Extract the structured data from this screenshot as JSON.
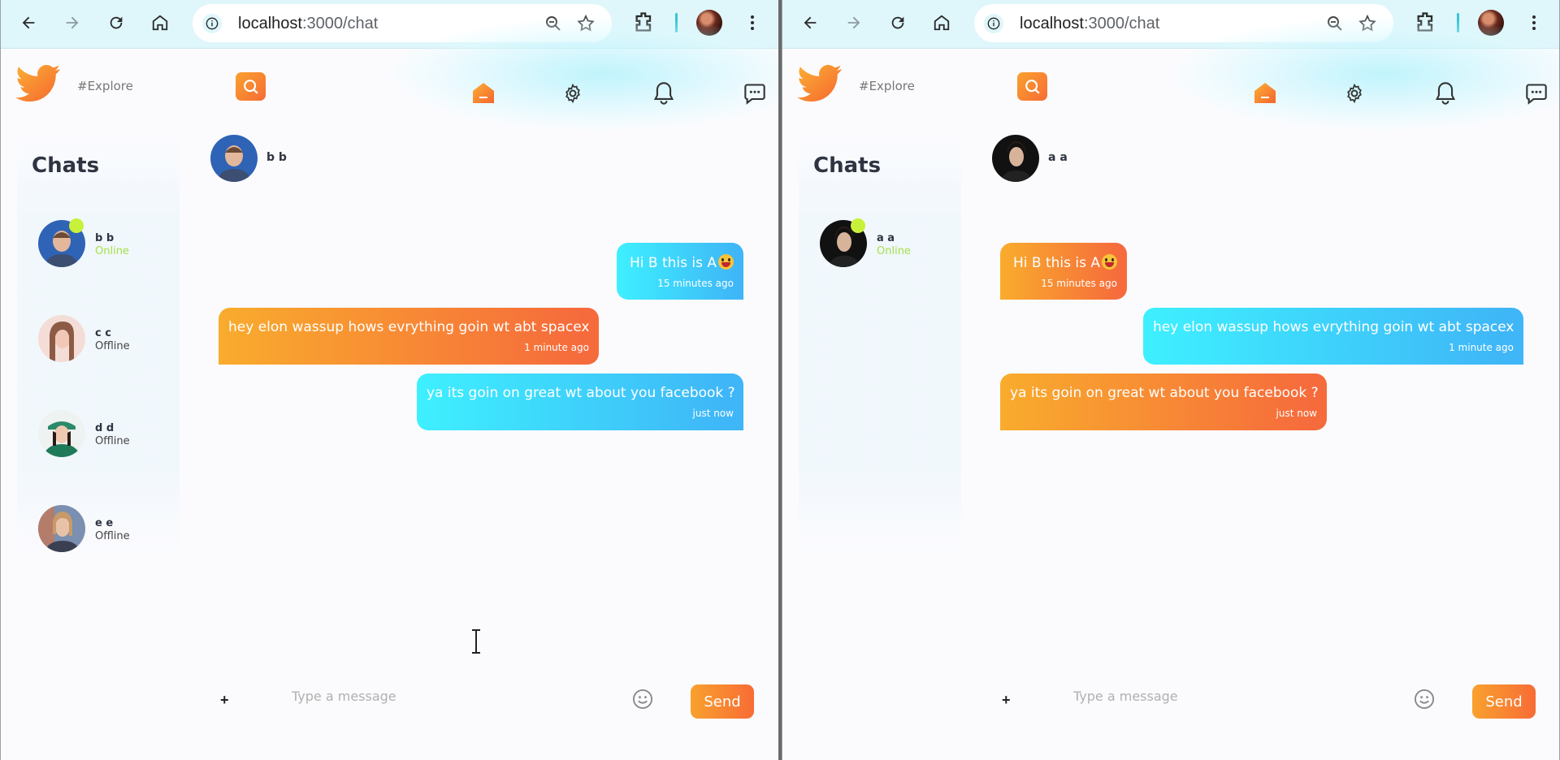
{
  "browser": {
    "url_host": "localhost",
    "url_path": ":3000/chat"
  },
  "header": {
    "explore_label": "#Explore"
  },
  "colors": {
    "accent_orange": "#f76c35",
    "accent_blue": "#3fb6f7",
    "online_green": "#c8f13a"
  },
  "windows": [
    {
      "chats_title": "Chats",
      "contacts": [
        {
          "name": "b b",
          "status": "Online",
          "online": true
        },
        {
          "name": "c c",
          "status": "Offline",
          "online": false
        },
        {
          "name": "d d",
          "status": "Offline",
          "online": false
        },
        {
          "name": "e e",
          "status": "Offline",
          "online": false
        }
      ],
      "conversation": {
        "name": "b b",
        "messages": [
          {
            "text": "Hi B this is A",
            "time": "15 minutes ago",
            "side": "right"
          },
          {
            "text": "hey elon wassup hows evrything goin wt abt spacex",
            "time": "1 minute ago",
            "side": "left"
          },
          {
            "text": "ya its goin on great wt about you facebook ?",
            "time": "just now",
            "side": "right"
          }
        ]
      },
      "input_placeholder": "Type a message",
      "send_label": "Send",
      "plus_label": "+"
    },
    {
      "chats_title": "Chats",
      "contacts": [
        {
          "name": "a a",
          "status": "Online",
          "online": true
        }
      ],
      "conversation": {
        "name": "a a",
        "messages": [
          {
            "text": "Hi B this is A",
            "time": "15 minutes ago",
            "side": "left"
          },
          {
            "text": "hey elon wassup hows evrything goin wt abt spacex",
            "time": "1 minute ago",
            "side": "right"
          },
          {
            "text": "ya its goin on great wt about you facebook ?",
            "time": "just now",
            "side": "left"
          }
        ]
      },
      "input_placeholder": "Type a message",
      "send_label": "Send",
      "plus_label": "+"
    }
  ]
}
